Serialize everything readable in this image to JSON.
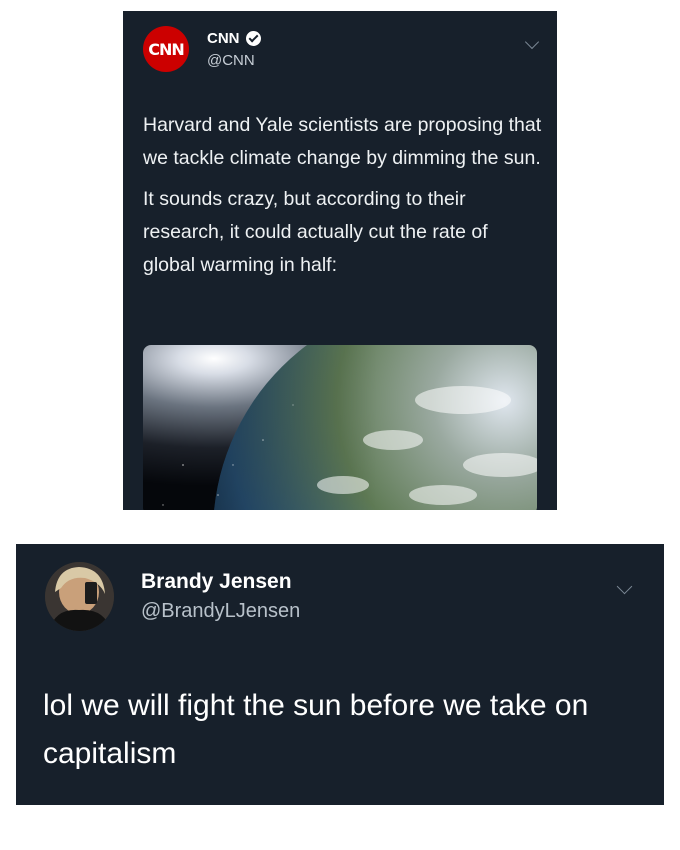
{
  "tweet_top": {
    "avatar_text": "CNN",
    "display_name": "CNN",
    "handle": "@CNN",
    "paragraphs": [
      "Harvard and Yale scientists are proposing that we tackle climate change by dimming the sun.",
      "It sounds crazy, but according to their research, it could actually cut the rate of global warming in half:"
    ],
    "media": "earth-from-space-image"
  },
  "tweet_bottom": {
    "display_name": "Brandy Jensen",
    "handle": "@BrandyLJensen",
    "text": "lol we will fight the sun before we take on capitalism"
  },
  "colors": {
    "tweet_bg": "#17202b",
    "cnn_red": "#cc0000",
    "page_bg": "#ffffff"
  }
}
